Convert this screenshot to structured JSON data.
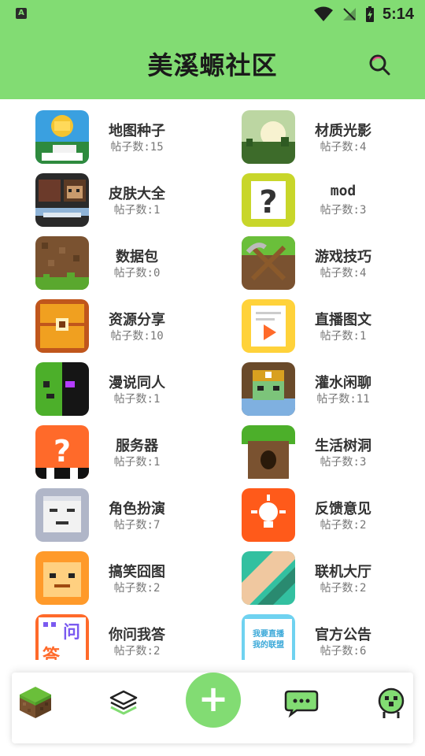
{
  "status": {
    "time": "5:14",
    "app_icon_letter": "A"
  },
  "header": {
    "title": "美溪螈社区"
  },
  "colors": {
    "brand_green": "#82dc73",
    "text_dark": "#333333",
    "text_muted": "#777777"
  },
  "boards": [
    {
      "name": "地图种子",
      "count_label": "帖子数:15",
      "icon": "map-seed-icon"
    },
    {
      "name": "材质光影",
      "count_label": "帖子数:4",
      "icon": "texture-shader-icon"
    },
    {
      "name": "皮肤大全",
      "count_label": "帖子数:1",
      "icon": "skin-icon"
    },
    {
      "name": "mod",
      "count_label": "帖子数:3",
      "icon": "mod-icon"
    },
    {
      "name": "数据包",
      "count_label": "帖子数:0",
      "icon": "datapack-icon"
    },
    {
      "name": "游戏技巧",
      "count_label": "帖子数:4",
      "icon": "tips-icon"
    },
    {
      "name": "资源分享",
      "count_label": "帖子数:10",
      "icon": "resource-chest-icon"
    },
    {
      "name": "直播图文",
      "count_label": "帖子数:1",
      "icon": "live-doc-icon"
    },
    {
      "name": "漫说同人",
      "count_label": "帖子数:1",
      "icon": "fanart-icon"
    },
    {
      "name": "灌水闲聊",
      "count_label": "帖子数:11",
      "icon": "chat-zombie-icon"
    },
    {
      "name": "服务器",
      "count_label": "帖子数:1",
      "icon": "server-icon"
    },
    {
      "name": "生活树洞",
      "count_label": "帖子数:3",
      "icon": "tree-hole-icon"
    },
    {
      "name": "角色扮演",
      "count_label": "帖子数:7",
      "icon": "roleplay-mask-icon"
    },
    {
      "name": "反馈意见",
      "count_label": "帖子数:2",
      "icon": "feedback-bulb-icon"
    },
    {
      "name": "搞笑囧图",
      "count_label": "帖子数:2",
      "icon": "funny-face-icon"
    },
    {
      "name": "联机大厅",
      "count_label": "帖子数:2",
      "icon": "multiplayer-icon"
    },
    {
      "name": "你问我答",
      "count_label": "帖子数:2",
      "icon": "qa-icon"
    },
    {
      "name": "官方公告",
      "count_label": "帖子数:6",
      "icon": "announcement-icon"
    }
  ],
  "qa_icon_text": {
    "top": "问",
    "bottom": "答"
  },
  "announcement_icon_text": {
    "top": "我要直播",
    "bottom": "我的联盟"
  },
  "mod_icon_text": "?",
  "server_icon_text": "?",
  "bottom_nav": [
    {
      "icon": "grass-block-icon"
    },
    {
      "icon": "layers-icon"
    },
    {
      "icon": "add-icon",
      "label": "+"
    },
    {
      "icon": "message-icon"
    },
    {
      "icon": "profile-creeper-icon"
    }
  ]
}
